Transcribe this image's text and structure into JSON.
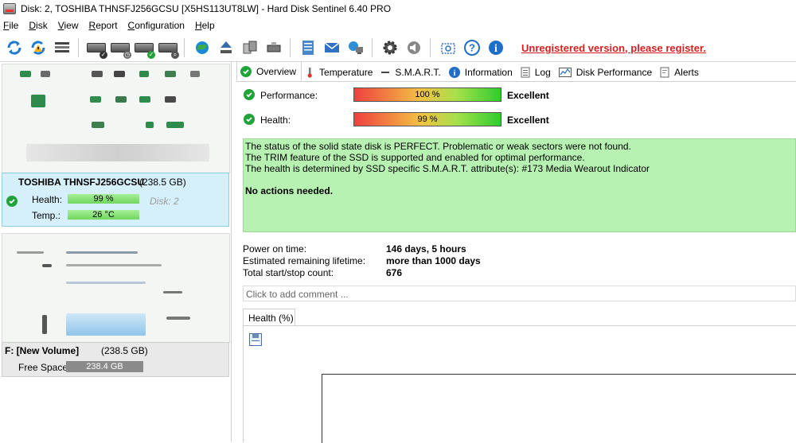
{
  "window": {
    "title": "Disk: 2, TOSHIBA THNSFJ256GCSU [X5HS113UT8LW]  -  Hard Disk Sentinel 6.40 PRO"
  },
  "menu": [
    {
      "label": "File",
      "mnemonic": "F",
      "rest": "ile"
    },
    {
      "label": "Disk",
      "mnemonic": "D",
      "rest": "isk"
    },
    {
      "label": "View",
      "mnemonic": "V",
      "rest": "iew"
    },
    {
      "label": "Report",
      "mnemonic": "R",
      "rest": "eport"
    },
    {
      "label": "Configuration",
      "mnemonic": "C",
      "rest": "onfiguration"
    },
    {
      "label": "Help",
      "mnemonic": "H",
      "rest": "elp"
    }
  ],
  "toolbar": {
    "icons": [
      "refresh-icon",
      "refresh-warning-icon",
      "disk-list-icon",
      "disk-check-icon",
      "disk-schedule-icon",
      "disk-ok-icon",
      "disk-search-icon",
      "globe-icon",
      "eject-icon",
      "devices-icon",
      "drive-icon",
      "report-icon",
      "mail-icon",
      "network-icon",
      "gear-icon",
      "speaker-icon",
      "camera-icon",
      "help-icon",
      "info-icon"
    ],
    "unregistered_text": "Unregistered version, please register."
  },
  "left": {
    "disk": {
      "name": "TOSHIBA THNSFJ256GCSU",
      "size": "(238.5 GB)",
      "health_label": "Health:",
      "health_value": "99 %",
      "disk_no": "Disk: 2",
      "temp_label": "Temp.:",
      "temp_value": "26 °C"
    },
    "volume": {
      "name": "F: [New Volume]",
      "size": "(238.5 GB)",
      "free_label": "Free Space",
      "free_value": "238.4 GB"
    }
  },
  "tabs": [
    {
      "label": "Overview",
      "icon": "check-circle-icon",
      "active": true
    },
    {
      "label": "Temperature",
      "icon": "thermometer-icon"
    },
    {
      "label": "S.M.A.R.T.",
      "icon": "smart-dash-icon"
    },
    {
      "label": "Information",
      "icon": "info-icon"
    },
    {
      "label": "Log",
      "icon": "log-icon"
    },
    {
      "label": "Disk Performance",
      "icon": "performance-chart-icon"
    },
    {
      "label": "Alerts",
      "icon": "alerts-icon"
    }
  ],
  "overview": {
    "performance": {
      "label": "Performance:",
      "value": "100 %",
      "verdict": "Excellent",
      "level": 1.0
    },
    "health": {
      "label": "Health:",
      "value": "99 %",
      "verdict": "Excellent",
      "level": 0.99
    },
    "status_lines": [
      "The status of the solid state disk is PERFECT. Problematic or weak sectors were not found.",
      "The TRIM feature of the SSD is supported and enabled for optimal performance.",
      "The health is determined by SSD specific S.M.A.R.T. attribute(s):  #173 Media Wearout Indicator"
    ],
    "action": "No actions needed.",
    "power_on_label": "Power on time:",
    "power_on_value": "146 days, 5 hours",
    "lifetime_label": "Estimated remaining lifetime:",
    "lifetime_value": "more than 1000 days",
    "startstop_label": "Total start/stop count:",
    "startstop_value": "676",
    "comment_placeholder": "Click to add comment ...",
    "health_tab": "Health (%)"
  },
  "colors": {
    "ok_green": "#21a33a",
    "status_bg": "#b8f2b2",
    "selected_bg": "#d5f0fb",
    "unregistered_red": "#d61f1f"
  }
}
